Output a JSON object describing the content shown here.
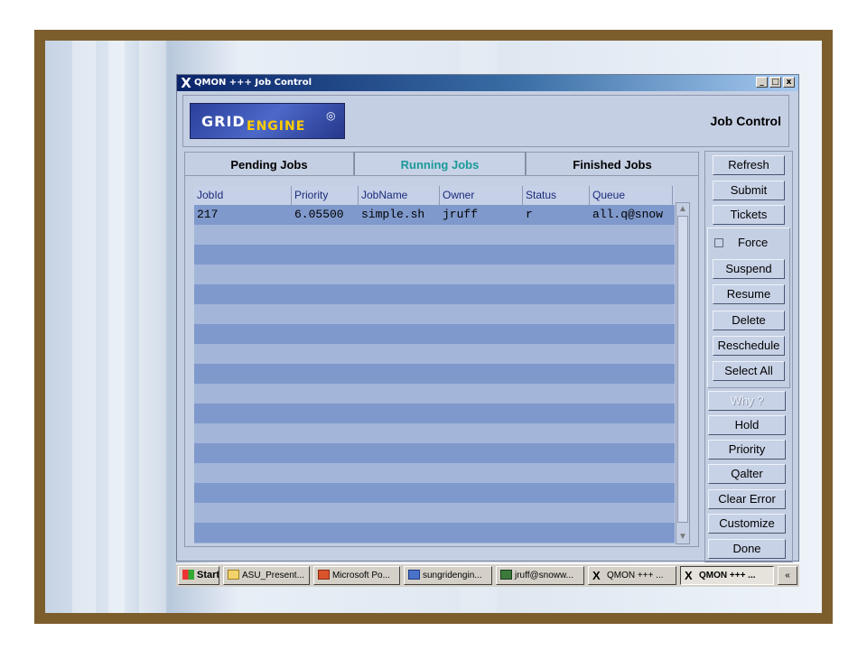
{
  "window": {
    "title": "QMON +++ Job Control",
    "controls": [
      "_",
      "□",
      "x"
    ]
  },
  "header": {
    "logo_grid": "GRID",
    "logo_engine": "ENGINE",
    "title": "Job Control"
  },
  "tabs": [
    {
      "label": "Pending Jobs",
      "active": false
    },
    {
      "label": "Running Jobs",
      "active": true
    },
    {
      "label": "Finished Jobs",
      "active": false
    }
  ],
  "table": {
    "columns": [
      "JobId",
      "Priority",
      "JobName",
      "Owner",
      "Status",
      "Queue"
    ],
    "rows": [
      {
        "jobid": "217",
        "priority": "6.05500",
        "jobname": "simple.sh",
        "owner": "jruff",
        "status": "r",
        "queue": "all.q@snow"
      }
    ]
  },
  "sidebar": {
    "refresh": "Refresh",
    "submit": "Submit",
    "tickets": "Tickets",
    "force": "Force",
    "suspend": "Suspend",
    "resume": "Resume",
    "delete": "Delete",
    "reschedule": "Reschedule",
    "select_all": "Select All",
    "why": "Why ?",
    "hold": "Hold",
    "priority": "Priority",
    "qalter": "Qalter",
    "clear_error": "Clear Error",
    "customize": "Customize",
    "done": "Done"
  },
  "taskbar": {
    "start": "Start",
    "items": [
      "ASU_Present...",
      "Microsoft Po...",
      "sungridengin...",
      "jruff@snoww...",
      "QMON +++ ...",
      "QMON +++ ..."
    ],
    "overflow": "«"
  },
  "colors": {
    "row_dark": "#7f99cc",
    "row_light": "#a3b6da",
    "selected_row": "#7f99cc",
    "active_tab_text": "#1a9a9a"
  }
}
